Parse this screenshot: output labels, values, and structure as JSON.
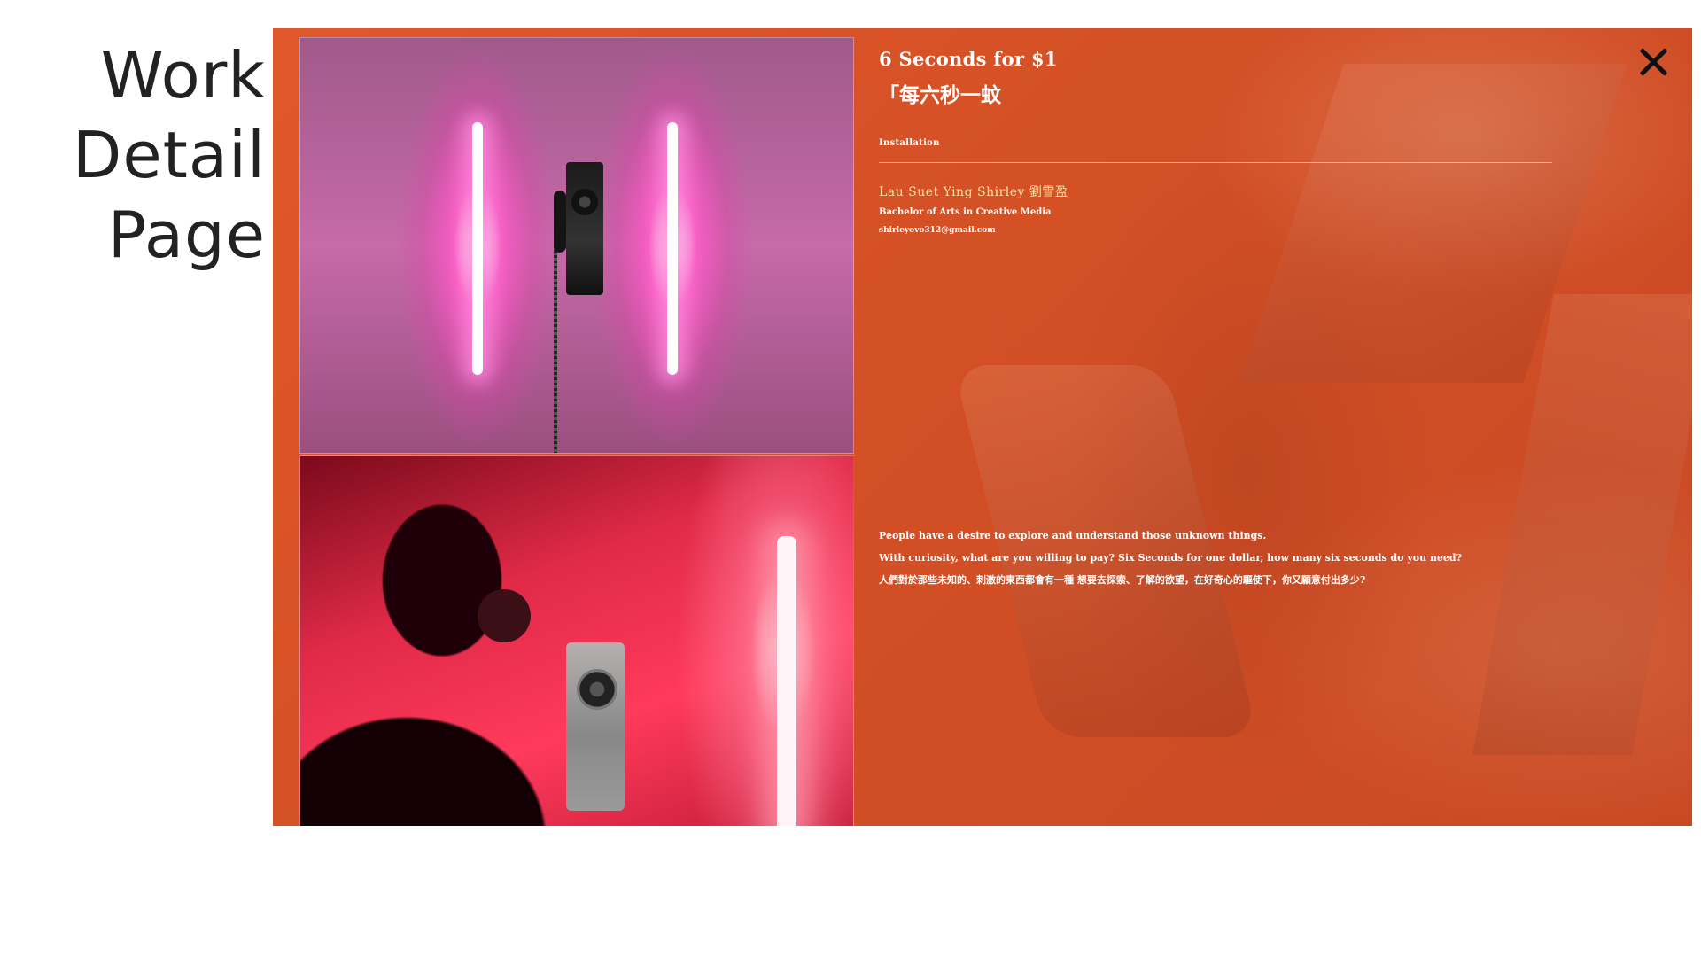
{
  "side_heading": {
    "line1": "Work",
    "line2": "Detail",
    "line3": "Page"
  },
  "work": {
    "title": "6 Seconds for $1",
    "subtitle": "「每六秒一蚊",
    "category": "Installation"
  },
  "artist": {
    "name": "Lau Suet Ying Shirley 劉雪盈",
    "program": "Bachelor of Arts in Creative Media",
    "email": "shirleyovo312@gmail.com"
  },
  "description": {
    "line1": "People have a desire to explore and understand those unknown things.",
    "line2": "With curiosity, what are you willing to pay? Six Seconds for one dollar, how many six seconds do you need?",
    "line3": "人們對於那些未知的、刺激的東西都會有一種 想要去探索、了解的欲望，在好奇心的驅使下，你又願意付出多少?"
  },
  "icons": {
    "close": "close-icon"
  },
  "colors": {
    "panel_accent": "#d9532a",
    "artist_name": "#f7e0a5",
    "text": "#ffffff"
  }
}
